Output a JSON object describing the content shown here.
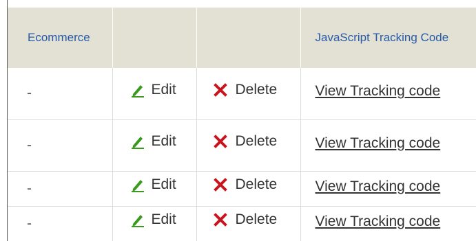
{
  "table": {
    "headers": {
      "ecommerce": "Ecommerce",
      "edit": "",
      "delete": "",
      "js_tracking": "JavaScript Tracking Code"
    },
    "rows": [
      {
        "ecommerce": "-",
        "edit_label": "Edit",
        "delete_label": "Delete",
        "tracking_link": "View Tracking code"
      },
      {
        "ecommerce": "-",
        "edit_label": "Edit",
        "delete_label": "Delete",
        "tracking_link": "View Tracking code"
      },
      {
        "ecommerce": "-",
        "edit_label": "Edit",
        "delete_label": "Delete",
        "tracking_link": "View Tracking code"
      },
      {
        "ecommerce": "-",
        "edit_label": "Edit",
        "delete_label": "Delete",
        "tracking_link": "View Tracking code"
      }
    ]
  },
  "icons": {
    "edit": "pencil-icon",
    "delete": "x-icon"
  },
  "colors": {
    "header_bg": "#e3e0d4",
    "header_text": "#255aa8",
    "edit_icon": "#3a9a1e",
    "delete_icon": "#c8141e",
    "row_border": "#dcdcdc"
  }
}
